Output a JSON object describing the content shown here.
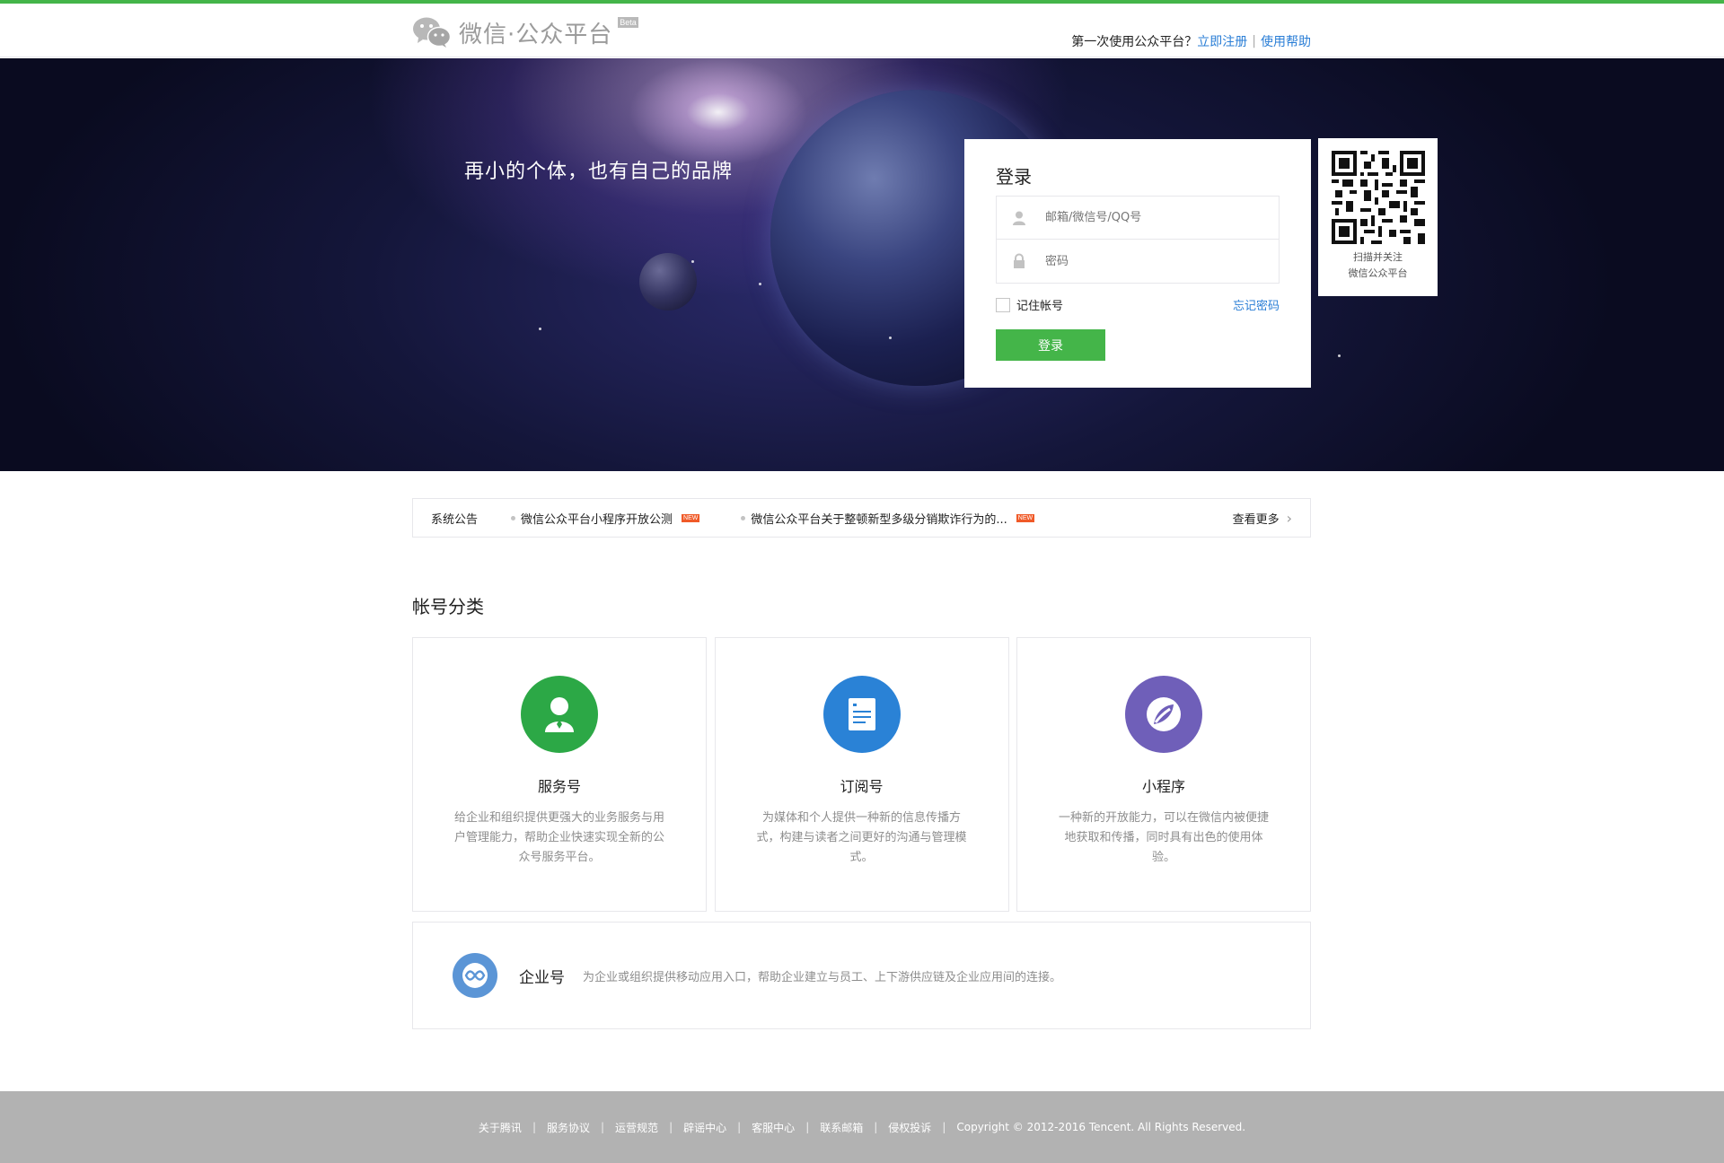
{
  "header": {
    "logo_text": "微信·公众平台",
    "beta": "Beta",
    "first_time_text": "第一次使用公众平台？",
    "register_link": "立即注册",
    "help_link": "使用帮助",
    "separator": "|"
  },
  "banner": {
    "slogan": "再小的个体，也有自己的品牌"
  },
  "login": {
    "title": "登录",
    "account_placeholder": "邮箱/微信号/QQ号",
    "password_placeholder": "密码",
    "remember_label": "记住帐号",
    "forgot_link": "忘记密码",
    "submit_label": "登录"
  },
  "qr": {
    "line1": "扫描并关注",
    "line2": "微信公众平台"
  },
  "notice": {
    "title": "系统公告",
    "items": [
      {
        "text": "微信公众平台小程序开放公测",
        "badge": "NEW"
      },
      {
        "text": "微信公众平台关于整顿新型多级分销欺诈行为的...",
        "badge": "NEW"
      }
    ],
    "more_label": "查看更多",
    "more_icon": "chevron-right-icon"
  },
  "account_types": {
    "title": "帐号分类",
    "cards": [
      {
        "name": "服务号",
        "desc": "给企业和组织提供更强大的业务服务与用户管理能力，帮助企业快速实现全新的公众号服务平台。",
        "icon": "service-account-icon",
        "color": "#2ca846"
      },
      {
        "name": "订阅号",
        "desc": "为媒体和个人提供一种新的信息传播方式，构建与读者之间更好的沟通与管理模式。",
        "icon": "subscription-account-icon",
        "color": "#2a82d6"
      },
      {
        "name": "小程序",
        "desc": "一种新的开放能力，可以在微信内被便捷地获取和传播，同时具有出色的使用体验。",
        "icon": "mini-program-icon",
        "color": "#6f5fb9"
      }
    ],
    "enterprise": {
      "name": "企业号",
      "desc": "为企业或组织提供移动应用入口，帮助企业建立与员工、上下游供应链及企业应用间的连接。",
      "icon": "enterprise-account-icon",
      "color": "#5b95d6"
    }
  },
  "footer": {
    "links": [
      "关于腾讯",
      "服务协议",
      "运营规范",
      "辟谣中心",
      "客服中心",
      "联系邮箱",
      "侵权投诉"
    ],
    "copyright": "Copyright © 2012-2016 Tencent. All Rights Reserved.",
    "separator": "|"
  },
  "colors": {
    "brand_green": "#44b549",
    "link_blue": "#2a7ed6"
  }
}
